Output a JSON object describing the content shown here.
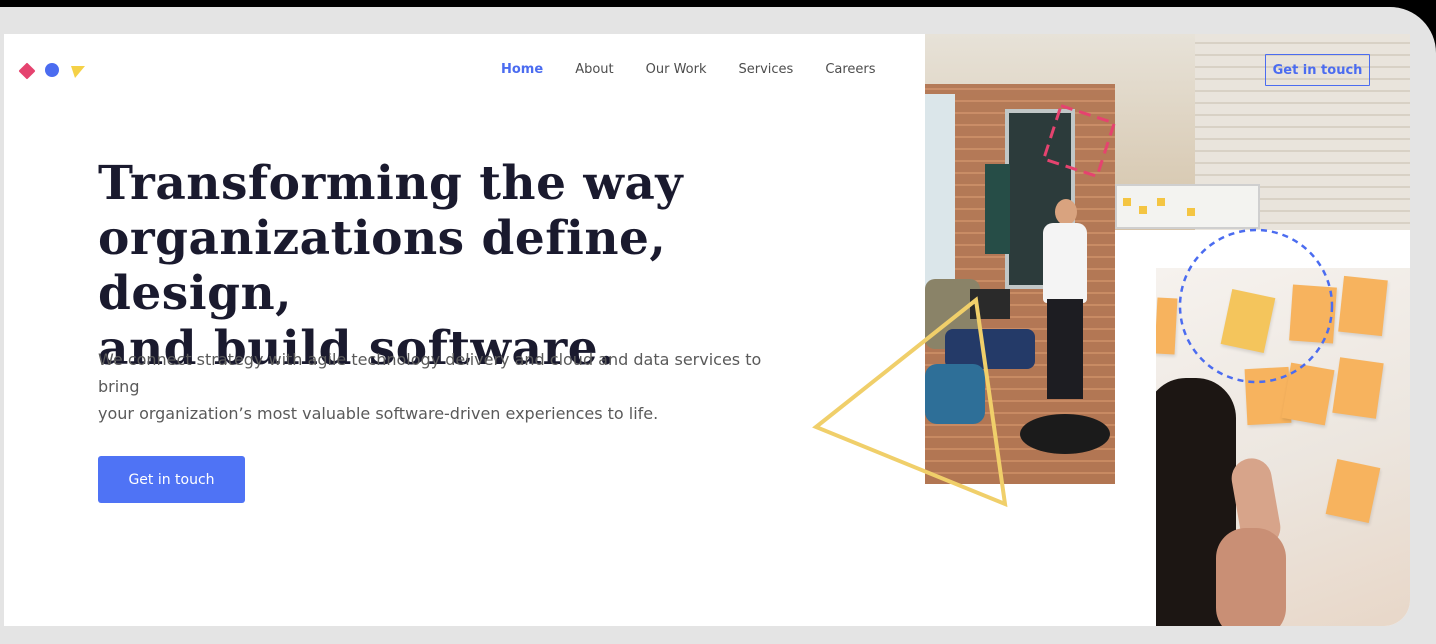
{
  "nav": {
    "items": [
      {
        "label": "Home",
        "active": true
      },
      {
        "label": "About"
      },
      {
        "label": "Our Work"
      },
      {
        "label": "Services"
      },
      {
        "label": "Careers"
      }
    ],
    "cta_label": "Get in touch"
  },
  "hero": {
    "headline_line1": "Transforming the way",
    "headline_line2": "organizations define, design,",
    "headline_line3": "and build software.",
    "subtext_line1": "We connect strategy with agile technology delivery and cloud and data services to bring",
    "subtext_line2": "your organization’s most valuable software-driven experiences to life.",
    "cta_label": "Get in touch"
  },
  "colors": {
    "accent_blue": "#4b6cf0",
    "button_blue": "#4f73f5",
    "logo_pink": "#e5436f",
    "logo_yellow": "#f5d147",
    "deco_triangle": "#f0cf6a"
  },
  "icons": [
    "logo-diamond-icon",
    "logo-circle-icon",
    "logo-triangle-icon"
  ]
}
